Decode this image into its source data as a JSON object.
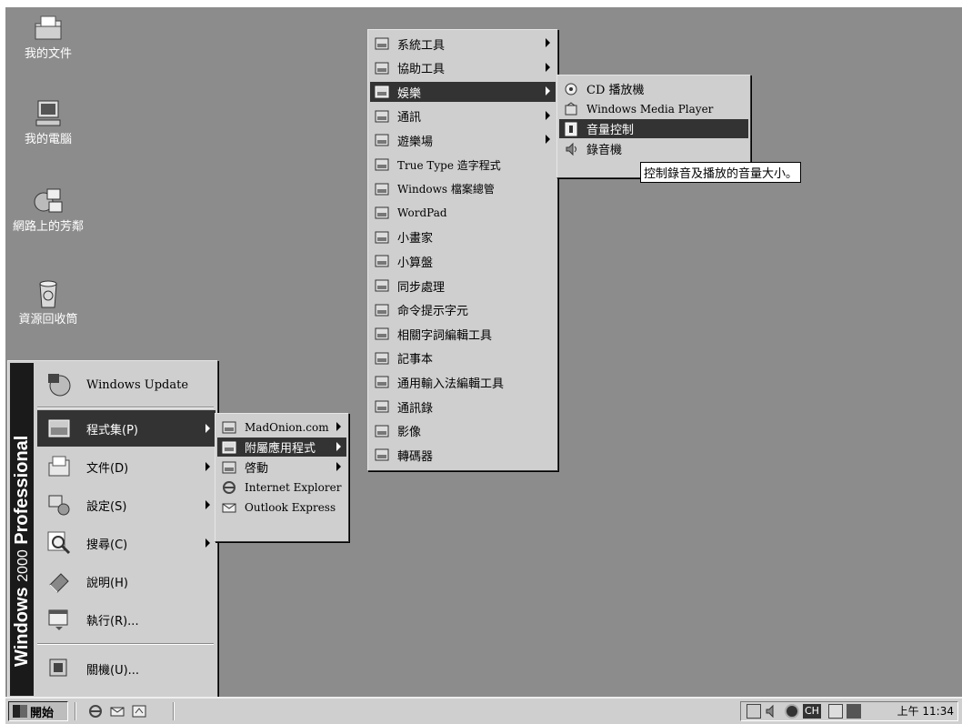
{
  "desktop_icons": [
    {
      "label": "我的文件",
      "icon": "folder-documents-icon"
    },
    {
      "label": "我的電腦",
      "icon": "computer-icon"
    },
    {
      "label": "網路上的芳鄰",
      "icon": "network-icon"
    },
    {
      "label": "資源回收筒",
      "icon": "recycle-bin-icon"
    }
  ],
  "start_menu": {
    "banner": {
      "bold": "Windows",
      "normal": "2000",
      "edition": "Professional"
    },
    "windows_update": "Windows Update",
    "items": [
      {
        "label": "程式集(P)",
        "icon": "programs-icon",
        "submenu": true
      },
      {
        "label": "文件(D)",
        "icon": "documents-icon",
        "submenu": true
      },
      {
        "label": "設定(S)",
        "icon": "settings-icon",
        "submenu": true
      },
      {
        "label": "搜尋(C)",
        "icon": "search-icon",
        "submenu": true
      },
      {
        "label": "說明(H)",
        "icon": "help-icon",
        "submenu": false
      },
      {
        "label": "執行(R)...",
        "icon": "run-icon",
        "submenu": false
      }
    ],
    "shutdown": "關機(U)..."
  },
  "programs_menu": [
    {
      "label": "MadOnion.com",
      "icon": "program-group-icon",
      "submenu": true
    },
    {
      "label": "附屬應用程式",
      "icon": "program-group-icon",
      "submenu": true
    },
    {
      "label": "啓動",
      "icon": "program-group-icon",
      "submenu": true
    },
    {
      "label": "Internet Explorer",
      "icon": "internet-explorer-icon",
      "submenu": false
    },
    {
      "label": "Outlook Express",
      "icon": "outlook-express-icon",
      "submenu": false
    }
  ],
  "accessories_menu": [
    {
      "label": "系統工具",
      "icon": "program-group-icon",
      "submenu": true
    },
    {
      "label": "協助工具",
      "icon": "program-group-icon",
      "submenu": true
    },
    {
      "label": "娛樂",
      "icon": "program-group-icon",
      "submenu": true
    },
    {
      "label": "通訊",
      "icon": "program-group-icon",
      "submenu": true
    },
    {
      "label": "遊樂場",
      "icon": "program-group-icon",
      "submenu": true
    },
    {
      "label": "True Type 造字程式",
      "icon": "font-editor-icon",
      "submenu": false
    },
    {
      "label": "Windows 檔案總管",
      "icon": "explorer-icon",
      "submenu": false
    },
    {
      "label": "WordPad",
      "icon": "wordpad-icon",
      "submenu": false
    },
    {
      "label": "小畫家",
      "icon": "paint-icon",
      "submenu": false
    },
    {
      "label": "小算盤",
      "icon": "calculator-icon",
      "submenu": false
    },
    {
      "label": "同步處理",
      "icon": "sync-icon",
      "submenu": false
    },
    {
      "label": "命令提示字元",
      "icon": "command-prompt-icon",
      "submenu": false
    },
    {
      "label": "相關字詞編輯工具",
      "icon": "phrase-editor-icon",
      "submenu": false
    },
    {
      "label": "記事本",
      "icon": "notepad-icon",
      "submenu": false
    },
    {
      "label": "通用輸入法編輯工具",
      "icon": "ime-editor-icon",
      "submenu": false
    },
    {
      "label": "通訊錄",
      "icon": "address-book-icon",
      "submenu": false
    },
    {
      "label": "影像",
      "icon": "imaging-icon",
      "submenu": false
    },
    {
      "label": "轉碼器",
      "icon": "code-converter-icon",
      "submenu": false
    }
  ],
  "entertainment_menu": [
    {
      "label": "CD 播放機",
      "icon": "cd-player-icon"
    },
    {
      "label": "Windows Media Player",
      "icon": "media-player-icon"
    },
    {
      "label": "音量控制",
      "icon": "volume-control-icon"
    },
    {
      "label": "錄音機",
      "icon": "sound-recorder-icon"
    }
  ],
  "tooltip": "控制錄音及播放的音量大小。",
  "taskbar": {
    "start_label": "開始",
    "quick_launch": [
      "internet-explorer-icon",
      "outlook-express-icon",
      "show-desktop-icon"
    ],
    "clock": "上午 11:34",
    "tray_ime": "CH"
  },
  "colors": {
    "desktop": "#8c8c8c",
    "menu": "#cfcfcf",
    "highlight": "#333333"
  }
}
